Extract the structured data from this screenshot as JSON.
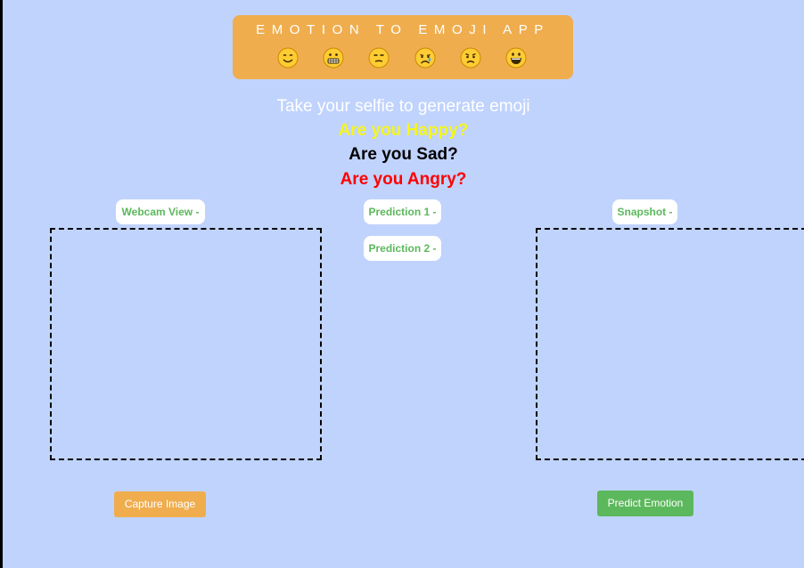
{
  "header": {
    "title": "EMOTION TO EMOJI APP",
    "emojis": [
      "smiling-face",
      "grimacing-face",
      "unamused-face",
      "crying-face",
      "frowning-face",
      "grinning-face"
    ]
  },
  "main": {
    "tagline": "Take your selfie to generate emoji",
    "questions": {
      "happy": "Are you Happy?",
      "sad": "Are you Sad?",
      "angry": "Are you Angry?"
    }
  },
  "labels": {
    "webcam": "Webcam View -",
    "prediction1": "Prediction 1 -",
    "prediction2": "Prediction 2 -",
    "snapshot": "Snapshot -"
  },
  "buttons": {
    "capture": "Capture Image",
    "predict": "Predict Emotion"
  },
  "colors": {
    "background": "#c0d3fd",
    "header": "#f0ad4e",
    "happy": "#f5f51f",
    "sad": "#000000",
    "angry": "#ff0000",
    "label_text": "#5cb85c",
    "capture_button": "#f0ad4e",
    "predict_button": "#5cb85c"
  }
}
